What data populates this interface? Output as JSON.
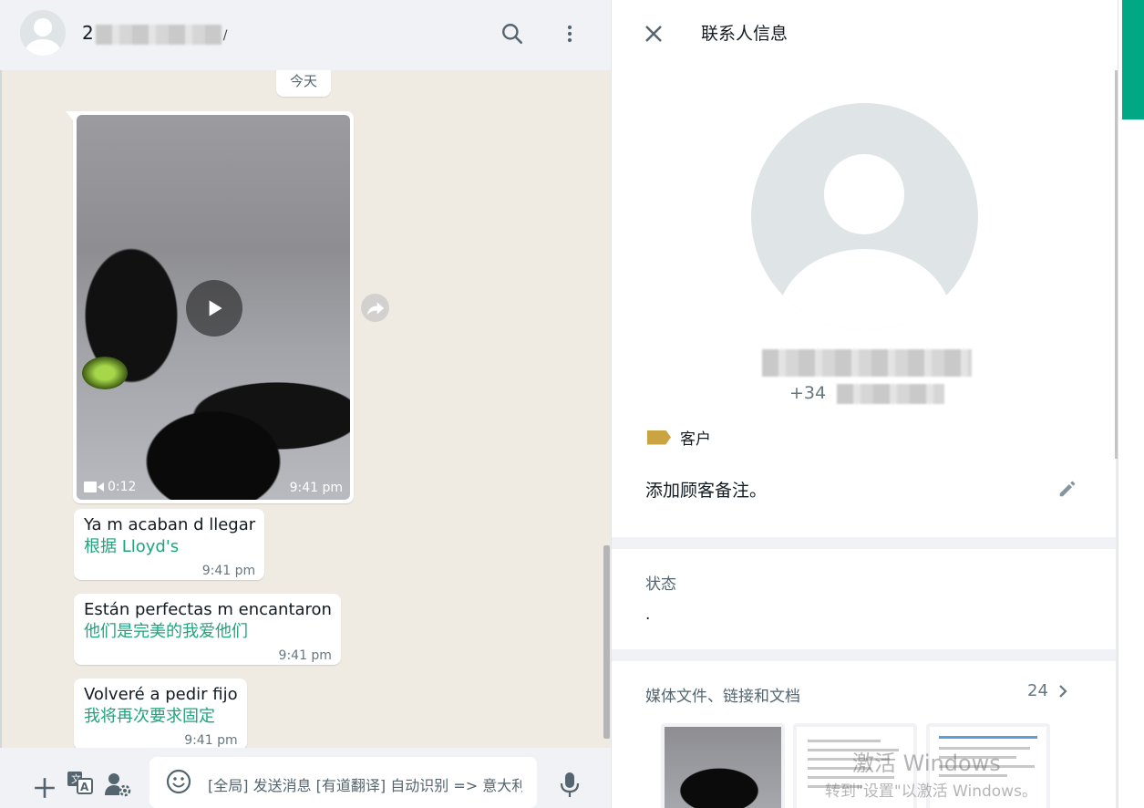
{
  "chat": {
    "contact_name_prefix": "2",
    "contact_name_suffix": "/",
    "date_divider": "今天",
    "video": {
      "duration": "0:12",
      "time": "9:41 pm"
    },
    "messages": [
      {
        "original": "Ya m acaban d llegar",
        "translation": "根据 Lloyd's",
        "time": "9:41 pm"
      },
      {
        "original": "Están perfectas m encantaron",
        "translation": "他们是完美的我爱他们",
        "time": "9:41 pm"
      },
      {
        "original": "Volveré a pedir fijo",
        "translation": "我将再次要求固定",
        "time": "9:41 pm"
      }
    ],
    "input_placeholder": "[全局] 发送消息 [有道翻译] 自动识别 => 意大利语"
  },
  "info": {
    "title": "联系人信息",
    "phone_prefix": "+34",
    "label": "客户",
    "note": "添加顾客备注。",
    "status_heading": "状态",
    "status_value": ".",
    "media_heading": "媒体文件、链接和文档",
    "media_count": "24"
  },
  "watermark": {
    "line1": "激活 Windows",
    "line2": "转到\"设置\"以激活 Windows。"
  },
  "colors": {
    "accent_green": "#00a884",
    "translation_green": "#1fa47e",
    "label_tag": "#c9a441",
    "chat_background": "#efeae2",
    "panel_background": "#f0f2f5"
  },
  "icons": {
    "header": [
      "search-icon",
      "menu-icon"
    ],
    "footer": [
      "plus-icon",
      "translate-icon",
      "user-settings-icon",
      "emoji-icon",
      "microphone-icon"
    ],
    "info": [
      "close-icon",
      "label-tag-icon",
      "pencil-icon",
      "chevron-right-icon"
    ]
  }
}
